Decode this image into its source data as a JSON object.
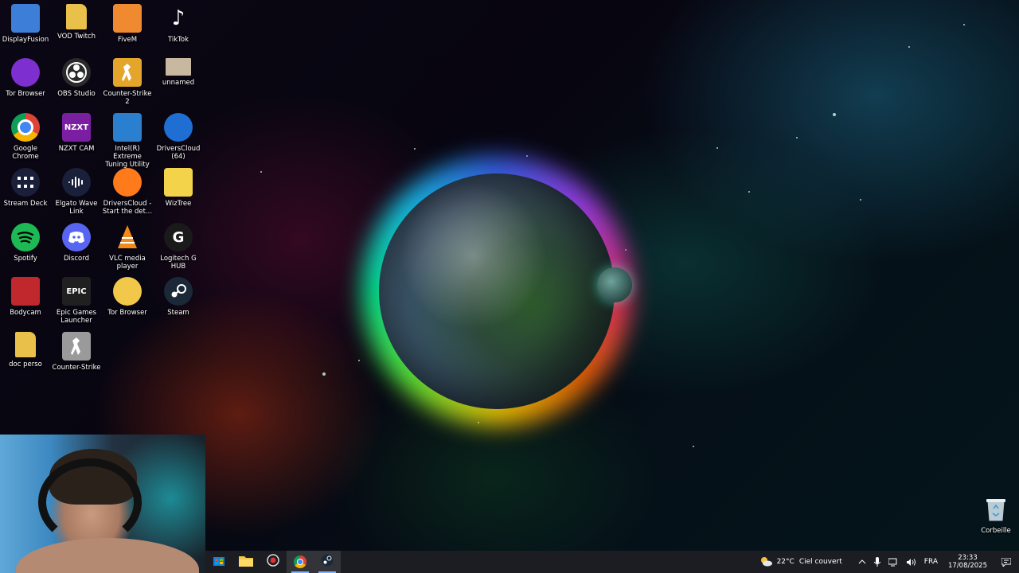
{
  "desktop": {
    "icons": [
      {
        "label": "DisplayFusion",
        "icon": "displayfusion-icon",
        "color": "#3d7fd8"
      },
      {
        "label": "VOD Twitch",
        "icon": "folder-icon",
        "color": "#e8c04a"
      },
      {
        "label": "FiveM",
        "icon": "fivem-icon",
        "color": "#f08a30"
      },
      {
        "label": "TikTok",
        "icon": "tiktok-icon",
        "color": "#ffffff"
      },
      {
        "label": "Tor Browser",
        "icon": "tor-browser-icon",
        "color": "#7d2fd0"
      },
      {
        "label": "OBS Studio",
        "icon": "obs-icon",
        "color": "#2a2a2a"
      },
      {
        "label": "Counter-Strike 2",
        "icon": "cs2-icon",
        "color": "#e3a52a"
      },
      {
        "label": "unnamed",
        "icon": "image-thumbnail-icon",
        "color": "#c8b8a0"
      },
      {
        "label": "Google Chrome",
        "icon": "chrome-icon",
        "color": "#4285f4"
      },
      {
        "label": "NZXT CAM",
        "icon": "nzxt-cam-icon",
        "color": "#7b1fa2"
      },
      {
        "label": "Intel(R) Extreme Tuning Utility",
        "icon": "intel-xtu-icon",
        "color": "#2a7fcf"
      },
      {
        "label": "DriversCloud (64)",
        "icon": "driverscloud-icon",
        "color": "#1f6ed4"
      },
      {
        "label": "Stream Deck",
        "icon": "stream-deck-icon",
        "color": "#1a1f3a"
      },
      {
        "label": "Elgato Wave Link",
        "icon": "wave-link-icon",
        "color": "#1a1f3a"
      },
      {
        "label": "DriversCloud - Start the det...",
        "icon": "firefox-icon",
        "color": "#ff7a1a"
      },
      {
        "label": "WizTree",
        "icon": "wiztree-icon",
        "color": "#f2d34a"
      },
      {
        "label": "Spotify",
        "icon": "spotify-icon",
        "color": "#1db954"
      },
      {
        "label": "Discord",
        "icon": "discord-icon",
        "color": "#5865f2"
      },
      {
        "label": "VLC media player",
        "icon": "vlc-icon",
        "color": "#f28a1a"
      },
      {
        "label": "Logitech G HUB",
        "icon": "logitech-ghub-icon",
        "color": "#1a1a1a"
      },
      {
        "label": "Bodycam",
        "icon": "bodycam-icon",
        "color": "#c0282e"
      },
      {
        "label": "Epic Games Launcher",
        "icon": "epic-games-icon",
        "color": "#202020"
      },
      {
        "label": "Tor Browser",
        "icon": "tor-browser-icon",
        "color": "#f2c84a"
      },
      {
        "label": "Steam",
        "icon": "steam-icon",
        "color": "#1b2838"
      },
      {
        "label": "doc perso",
        "icon": "folder-icon",
        "color": "#e8c04a"
      },
      {
        "label": "Counter-Strike",
        "icon": "counter-strike-icon",
        "color": "#9a9a9a"
      }
    ],
    "recycle_bin": {
      "label": "Corbeille",
      "icon": "recycle-bin-icon"
    }
  },
  "taskbar": {
    "buttons": [
      {
        "name": "start-store-button",
        "icon": "microsoft-store-icon",
        "active": false
      },
      {
        "name": "file-explorer-button",
        "icon": "file-explorer-icon",
        "active": false
      },
      {
        "name": "recording-app-button",
        "icon": "record-icon",
        "active": false
      },
      {
        "name": "chrome-taskbar-button",
        "icon": "chrome-icon",
        "active": true
      },
      {
        "name": "steam-taskbar-button",
        "icon": "steam-icon",
        "active": true
      }
    ],
    "weather": {
      "temp": "22°C",
      "condition": "Ciel couvert",
      "icon": "partly-cloudy-icon"
    },
    "language": "FRA",
    "time": "23:33",
    "date": "17/08/2025"
  }
}
